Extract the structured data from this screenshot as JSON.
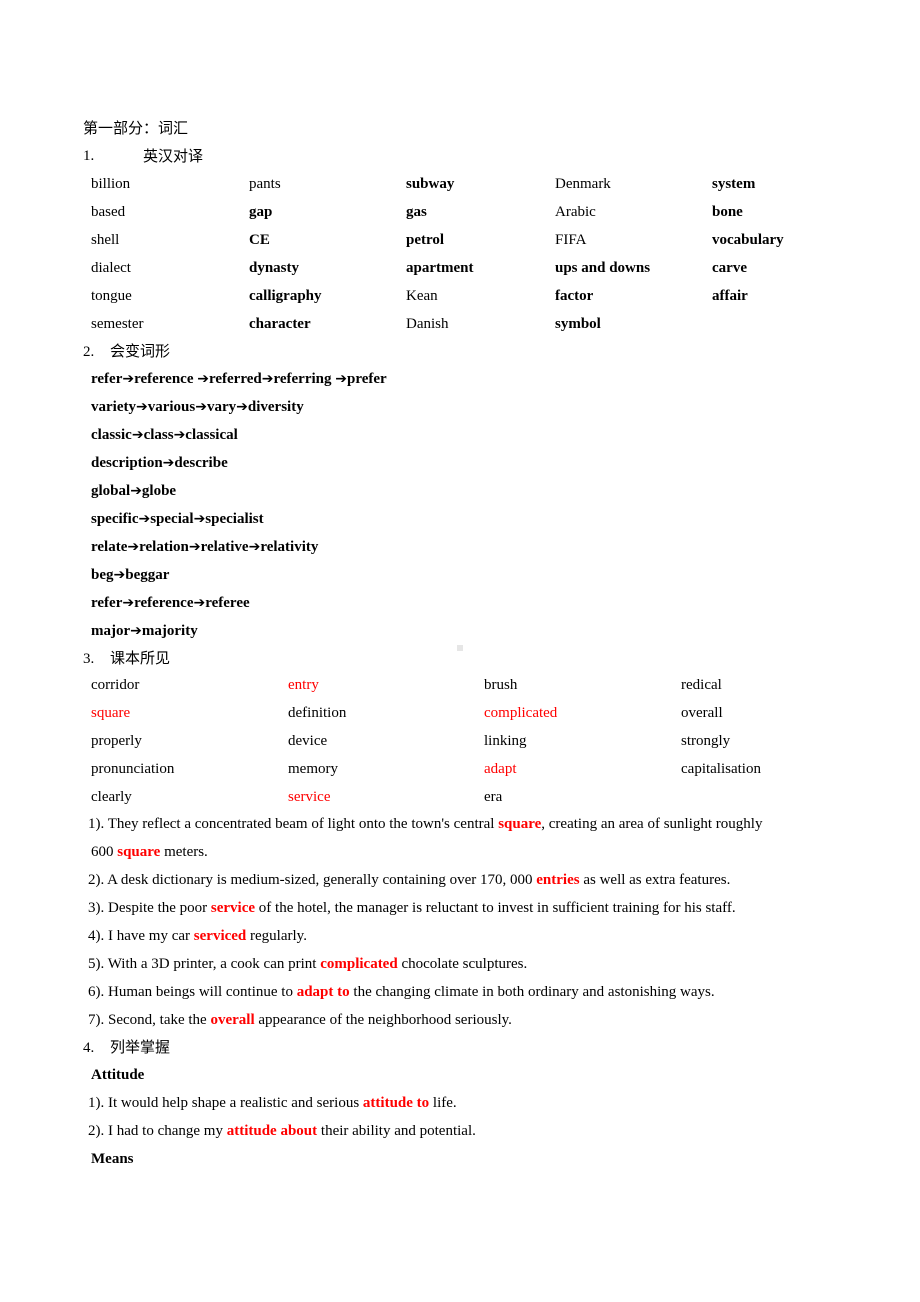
{
  "part_title": "第一部分：词汇",
  "section1": {
    "number": "1.",
    "title": "英汉对译",
    "rows": [
      [
        {
          "text": "billion",
          "bold": false
        },
        {
          "text": "pants",
          "bold": false
        },
        {
          "text": "subway",
          "bold": true
        },
        {
          "text": "Denmark",
          "bold": false
        },
        {
          "text": "system",
          "bold": true
        }
      ],
      [
        {
          "text": "based",
          "bold": false
        },
        {
          "text": "gap",
          "bold": true
        },
        {
          "text": "gas",
          "bold": true
        },
        {
          "text": "Arabic",
          "bold": false
        },
        {
          "text": "bone",
          "bold": true
        }
      ],
      [
        {
          "text": "shell",
          "bold": false
        },
        {
          "text": "CE",
          "bold": true
        },
        {
          "text": "petrol",
          "bold": true
        },
        {
          "text": "FIFA",
          "bold": false
        },
        {
          "text": "vocabulary",
          "bold": true
        }
      ],
      [
        {
          "text": "dialect",
          "bold": false
        },
        {
          "text": "dynasty",
          "bold": true
        },
        {
          "text": "apartment",
          "bold": true
        },
        {
          "text": "ups and downs",
          "bold": true
        },
        {
          "text": "carve",
          "bold": true
        }
      ],
      [
        {
          "text": "tongue",
          "bold": false
        },
        {
          "text": "calligraphy",
          "bold": true
        },
        {
          "text": "Kean",
          "bold": false
        },
        {
          "text": "factor",
          "bold": true
        },
        {
          "text": "affair",
          "bold": true
        }
      ],
      [
        {
          "text": "semester",
          "bold": false
        },
        {
          "text": "character",
          "bold": true
        },
        {
          "text": "Danish",
          "bold": false
        },
        {
          "text": "symbol",
          "bold": true
        }
      ]
    ]
  },
  "section2": {
    "number": "2.",
    "title": "会变词形",
    "arrow_icon": "➔",
    "chains": [
      [
        "refer",
        "reference ",
        "referred",
        "referring ",
        "prefer"
      ],
      [
        "variety",
        "various",
        "vary",
        "diversity"
      ],
      [
        "classic",
        "class",
        "classical"
      ],
      [
        "description",
        "describe"
      ],
      [
        "global",
        "globe"
      ],
      [
        "specific",
        "special",
        "specialist"
      ],
      [
        "relate",
        "relation",
        "relative",
        "relativity"
      ],
      [
        "beg",
        "beggar"
      ],
      [
        "refer",
        "reference",
        "referee"
      ],
      [
        "major",
        "majority"
      ]
    ]
  },
  "section3": {
    "number": "3.",
    "title": "课本所见",
    "rows": [
      [
        {
          "text": " corridor",
          "red": false
        },
        {
          "text": "entry",
          "red": true
        },
        {
          "text": "brush",
          "red": false
        },
        {
          "text": "redical",
          "red": false
        }
      ],
      [
        {
          "text": "square",
          "red": true
        },
        {
          "text": "definition",
          "red": false
        },
        {
          "text": "complicated",
          "red": true
        },
        {
          "text": "overall",
          "red": false
        }
      ],
      [
        {
          "text": "properly",
          "red": false
        },
        {
          "text": "device",
          "red": false
        },
        {
          "text": "linking",
          "red": false
        },
        {
          "text": "strongly",
          "red": false
        }
      ],
      [
        {
          "text": "pronunciation",
          "red": false
        },
        {
          "text": "memory",
          "red": false
        },
        {
          "text": "adapt",
          "red": true
        },
        {
          "text": "capitalisation",
          "red": false
        }
      ],
      [
        {
          "text": "clearly",
          "red": false
        },
        {
          "text": "service",
          "red": true
        },
        {
          "text": "era",
          "red": false
        }
      ]
    ],
    "sentences": [
      {
        "lines": [
          [
            {
              "t": "1). They reflect a concentrated beam of light onto the town's central "
            },
            {
              "t": "square",
              "hl": true
            },
            {
              "t": ", creating an area of sunlight roughly"
            }
          ],
          [
            {
              "t": "600 "
            },
            {
              "t": "square",
              "hl": true
            },
            {
              "t": " meters."
            }
          ]
        ]
      },
      {
        "lines": [
          [
            {
              "t": "2). A desk dictionary is medium-sized, generally containing over 170, 000 "
            },
            {
              "t": "entries",
              "hl": true
            },
            {
              "t": " as well as extra features."
            }
          ]
        ]
      },
      {
        "lines": [
          [
            {
              "t": "3). Despite the poor "
            },
            {
              "t": "service",
              "hl": true
            },
            {
              "t": " of the hotel, the manager is reluctant to invest in sufficient training for his staff."
            }
          ]
        ]
      },
      {
        "lines": [
          [
            {
              "t": "4). I have my car "
            },
            {
              "t": "serviced",
              "hl": true
            },
            {
              "t": " regularly."
            }
          ]
        ]
      },
      {
        "lines": [
          [
            {
              "t": "5). With a 3D printer, a cook can print "
            },
            {
              "t": "complicated",
              "hl": true
            },
            {
              "t": " chocolate sculptures."
            }
          ]
        ]
      },
      {
        "lines": [
          [
            {
              "t": "6). Human beings will continue to "
            },
            {
              "t": "adapt to",
              "hl": true
            },
            {
              "t": " the changing climate in both ordinary and astonishing ways."
            }
          ]
        ]
      },
      {
        "lines": [
          [
            {
              "t": "7). Second, take the "
            },
            {
              "t": "overall",
              "hl": true
            },
            {
              "t": " appearance of the neighborhood seriously."
            }
          ]
        ]
      }
    ]
  },
  "section4": {
    "number": "4.",
    "title": "列举掌握",
    "groups": [
      {
        "heading": "Attitude",
        "sentences": [
          [
            {
              "t": "1). It would help shape a realistic and serious "
            },
            {
              "t": "attitude to",
              "hl": true
            },
            {
              "t": " life."
            }
          ],
          [
            {
              "t": "2). I had to change my "
            },
            {
              "t": "attitude about",
              "hl": true
            },
            {
              "t": " their ability and potential."
            }
          ]
        ]
      },
      {
        "heading": "Means",
        "sentences": []
      }
    ]
  },
  "colors": {
    "highlight": "#ff0000",
    "text": "#000000"
  }
}
